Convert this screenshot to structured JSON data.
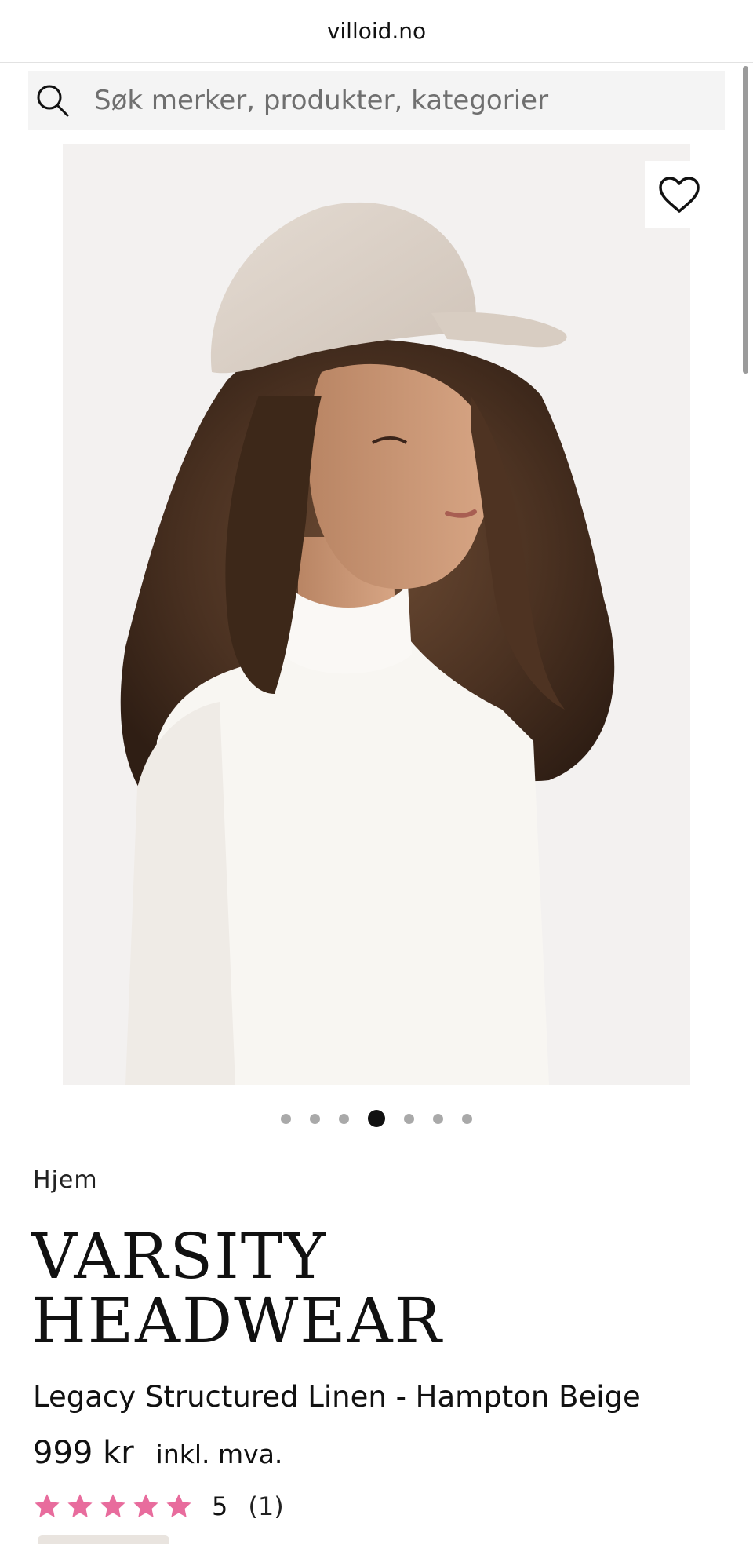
{
  "browser": {
    "url": "villoid.no"
  },
  "search": {
    "placeholder": "Søk merker, produkter, kategorier",
    "icon": "search-icon"
  },
  "gallery": {
    "image_count": 7,
    "active_index": 3,
    "wishlist_icon": "heart-icon"
  },
  "breadcrumb": {
    "home": "Hjem"
  },
  "product": {
    "brand_line1": "VARSITY",
    "brand_line2": "HEADWEAR",
    "name": "Legacy Structured Linen - Hampton Beige",
    "price": "999 kr",
    "vat_note": "inkl. mva.",
    "rating": {
      "stars": 5,
      "score": "5",
      "count": "(1)",
      "star_color": "#e86c9d"
    }
  },
  "colors": {
    "text": "#111111",
    "search_bg": "#f4f4f4",
    "dot_inactive": "#a9a9a9",
    "dot_active": "#111111"
  }
}
